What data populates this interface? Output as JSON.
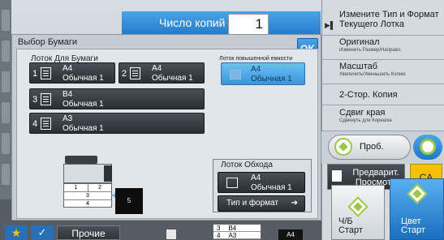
{
  "copies": {
    "label": "Число копий",
    "value": "1"
  },
  "right_menu": [
    {
      "title": "Измените Тип и Формат Текущего Лотка",
      "sub": ""
    },
    {
      "title": "Оригинал",
      "sub": "Изменить Размер/Направл."
    },
    {
      "title": "Масштаб",
      "sub": "Увеличить/Уменьшить Копию"
    },
    {
      "title": "2-Стор. Копия",
      "sub": ""
    },
    {
      "title": "Сдвиг края",
      "sub": "Сдвинуть для Корешка"
    }
  ],
  "proof_copy": "Проб. Копия",
  "preview": "Предварит. Просмотр",
  "ca": "CA",
  "start_bw": {
    "line1": "Ч/Б",
    "line2": "Старт"
  },
  "start_color": {
    "line1": "Цвет",
    "line2": "Старт"
  },
  "bottom": {
    "other": "Прочие",
    "tray_rows": [
      [
        "3",
        "B4"
      ],
      [
        "4",
        "A3"
      ]
    ],
    "out": "A4"
  },
  "dialog": {
    "title": "Выбор Бумаги",
    "ok": "OK",
    "trays_label": "Лоток Для Бумаги",
    "bypass_top_label": "Лоток повышенной емкости",
    "trays": [
      {
        "num": "1",
        "size": "A4",
        "type": "Обычная 1"
      },
      {
        "num": "2",
        "size": "A4",
        "type": "Обычная 1"
      },
      {
        "num": "3",
        "size": "B4",
        "type": "Обычная 1"
      },
      {
        "num": "4",
        "size": "A3",
        "type": "Обычная 1"
      }
    ],
    "bypass_top": {
      "size": "A4",
      "type": "Обычная 1"
    },
    "machine": {
      "drawers": [
        "1",
        "2",
        "3",
        "4"
      ],
      "out": "5"
    },
    "bypass": {
      "label": "Лоток Обхода",
      "size": "A4",
      "type": "Обычная 1",
      "type_format": "Тип и формат"
    }
  }
}
